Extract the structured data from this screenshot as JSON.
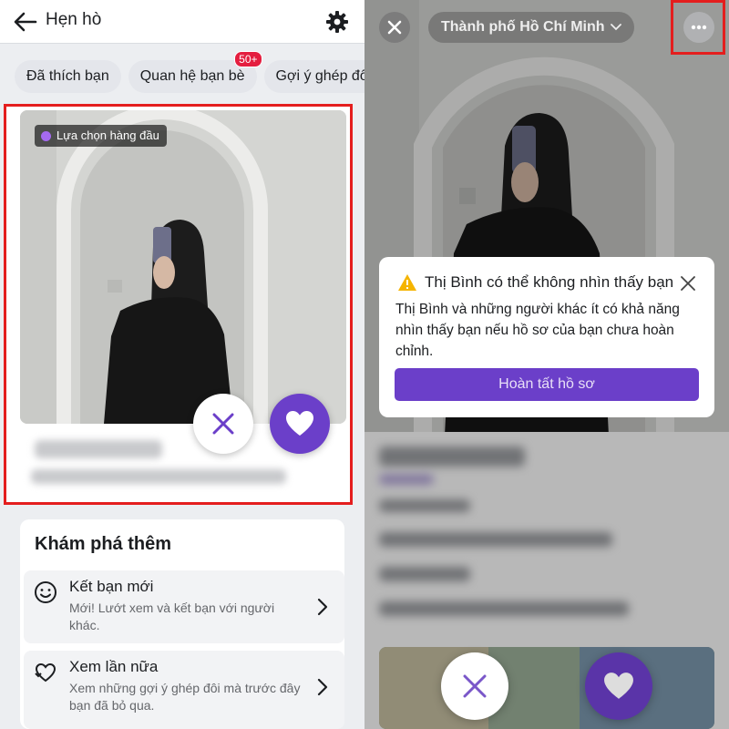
{
  "left": {
    "header": {
      "title": "Hẹn hò"
    },
    "chips": [
      {
        "label": "Đã thích bạn",
        "badge": ""
      },
      {
        "label": "Quan hệ bạn bè",
        "badge": "50+"
      },
      {
        "label": "Gợi ý ghép đôi",
        "badge": ""
      }
    ],
    "card": {
      "tag": "Lựa chọn hàng đầu"
    },
    "explore": {
      "title": "Khám phá thêm",
      "items": [
        {
          "title": "Kết bạn mới",
          "desc": "Mới! Lướt xem và kết bạn với người khác."
        },
        {
          "title": "Xem lần nữa",
          "desc": "Xem những gợi ý ghép đôi mà trước đây bạn đã bỏ qua."
        }
      ]
    }
  },
  "right": {
    "city": "Thành phố Hồ Chí Minh",
    "notice": {
      "title": "Thị Bình có thể không nhìn thấy bạn",
      "body": "Thị Bình và những người khác ít có khả năng nhìn thấy bạn nếu hồ sơ của bạn chưa hoàn chỉnh.",
      "button": "Hoàn tất hồ sơ"
    }
  },
  "colors": {
    "accent": "#6b3fc9",
    "highlight": "#e41e1e",
    "badge": "#e41e3f"
  },
  "icons": [
    "back-arrow-icon",
    "gear-icon",
    "close-icon",
    "heart-icon",
    "smiley-icon",
    "rewind-heart-icon",
    "chevron-right-icon",
    "more-icon",
    "warning-icon",
    "chevron-down-icon"
  ]
}
